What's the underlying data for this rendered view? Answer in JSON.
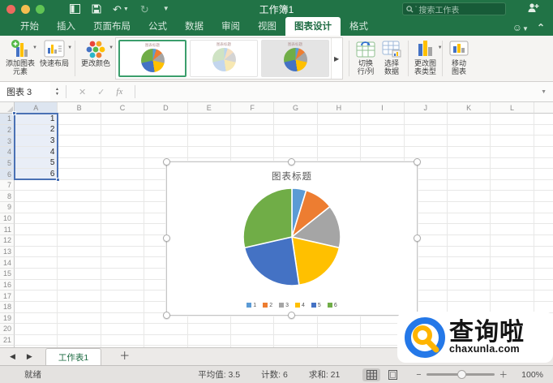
{
  "titlebar": {
    "title": "工作簿1",
    "search_placeholder": "搜索工作表"
  },
  "menu_tabs": {
    "items": [
      {
        "label": "开始",
        "active": false
      },
      {
        "label": "插入",
        "active": false
      },
      {
        "label": "页面布局",
        "active": false
      },
      {
        "label": "公式",
        "active": false
      },
      {
        "label": "数据",
        "active": false
      },
      {
        "label": "审阅",
        "active": false
      },
      {
        "label": "视图",
        "active": false
      },
      {
        "label": "图表设计",
        "active": true
      },
      {
        "label": "格式",
        "active": false
      }
    ]
  },
  "ribbon": {
    "add_chart_element": "添加图表\n元素",
    "quick_layout": "快速布局",
    "change_colors": "更改颜色",
    "switch_row_col": "切换\n行/列",
    "select_data": "选择\n数据",
    "change_chart_type": "更改图\n表类型",
    "move_chart": "移动\n图表"
  },
  "gallery": {
    "items": [
      {
        "selected": true,
        "bg": "#ffffff",
        "palette": [
          "#5B9BD5",
          "#ED7D31",
          "#A5A5A5",
          "#FFC000",
          "#4472C4",
          "#70AD47"
        ]
      },
      {
        "selected": false,
        "bg": "#ffffff",
        "palette": [
          "#bcd5ec",
          "#f6dfc0",
          "#d4d4d4",
          "#f7e8b3",
          "#c3d6ee",
          "#cfe3c4"
        ]
      },
      {
        "selected": false,
        "bg": "#e4e4e4",
        "palette": [
          "#5B9BD5",
          "#ED7D31",
          "#A5A5A5",
          "#FFC000",
          "#4472C4",
          "#70AD47"
        ]
      }
    ]
  },
  "formula_bar": {
    "name_box": "图表 3"
  },
  "grid": {
    "columns": [
      "A",
      "B",
      "C",
      "D",
      "E",
      "F",
      "G",
      "H",
      "I",
      "J",
      "K",
      "L",
      ""
    ],
    "row_count": 22,
    "a_values": [
      "1",
      "2",
      "3",
      "4",
      "5",
      "6"
    ],
    "selected_rows": 6
  },
  "chart_data": {
    "type": "pie",
    "title": "图表标题",
    "categories": [
      "1",
      "2",
      "3",
      "4",
      "5",
      "6"
    ],
    "values": [
      1,
      2,
      3,
      4,
      5,
      6
    ],
    "colors": [
      "#5B9BD5",
      "#ED7D31",
      "#A5A5A5",
      "#FFC000",
      "#4472C4",
      "#70AD47"
    ],
    "legend_position": "bottom"
  },
  "sheet_bar": {
    "tabs": [
      {
        "label": "工作表1",
        "active": true
      }
    ]
  },
  "status_bar": {
    "ready": "就绪",
    "average": "平均值: 3.5",
    "count": "计数: 6",
    "sum": "求和: 21",
    "zoom": "100%"
  },
  "watermark": {
    "brand": "查询啦",
    "domain": "chaxunla.com"
  },
  "icons": {
    "caret_down": "▼",
    "gallery_next": "▶",
    "sheet_prev": "◀",
    "sheet_next": "▶",
    "add_sheet": "＋",
    "cancel": "✕",
    "confirm": "✓",
    "fx": "fx",
    "stepper_up": "▲",
    "stepper_down": "▼",
    "undo": "↶",
    "redo": "↻",
    "toolbar_more": "▼",
    "smiley": "☺",
    "collapse_ribbon": "⌃",
    "zoom_out": "−",
    "zoom_in": "＋",
    "search_caret": "ˇ"
  },
  "colors": {
    "excel_green": "#217346",
    "selection_blue": "#4A71B4",
    "traffic_red": "#ED6A5E",
    "traffic_yellow": "#F4BE50",
    "traffic_green": "#61C454",
    "logo_blue": "#2478E8",
    "logo_yellow": "#FFB400"
  }
}
